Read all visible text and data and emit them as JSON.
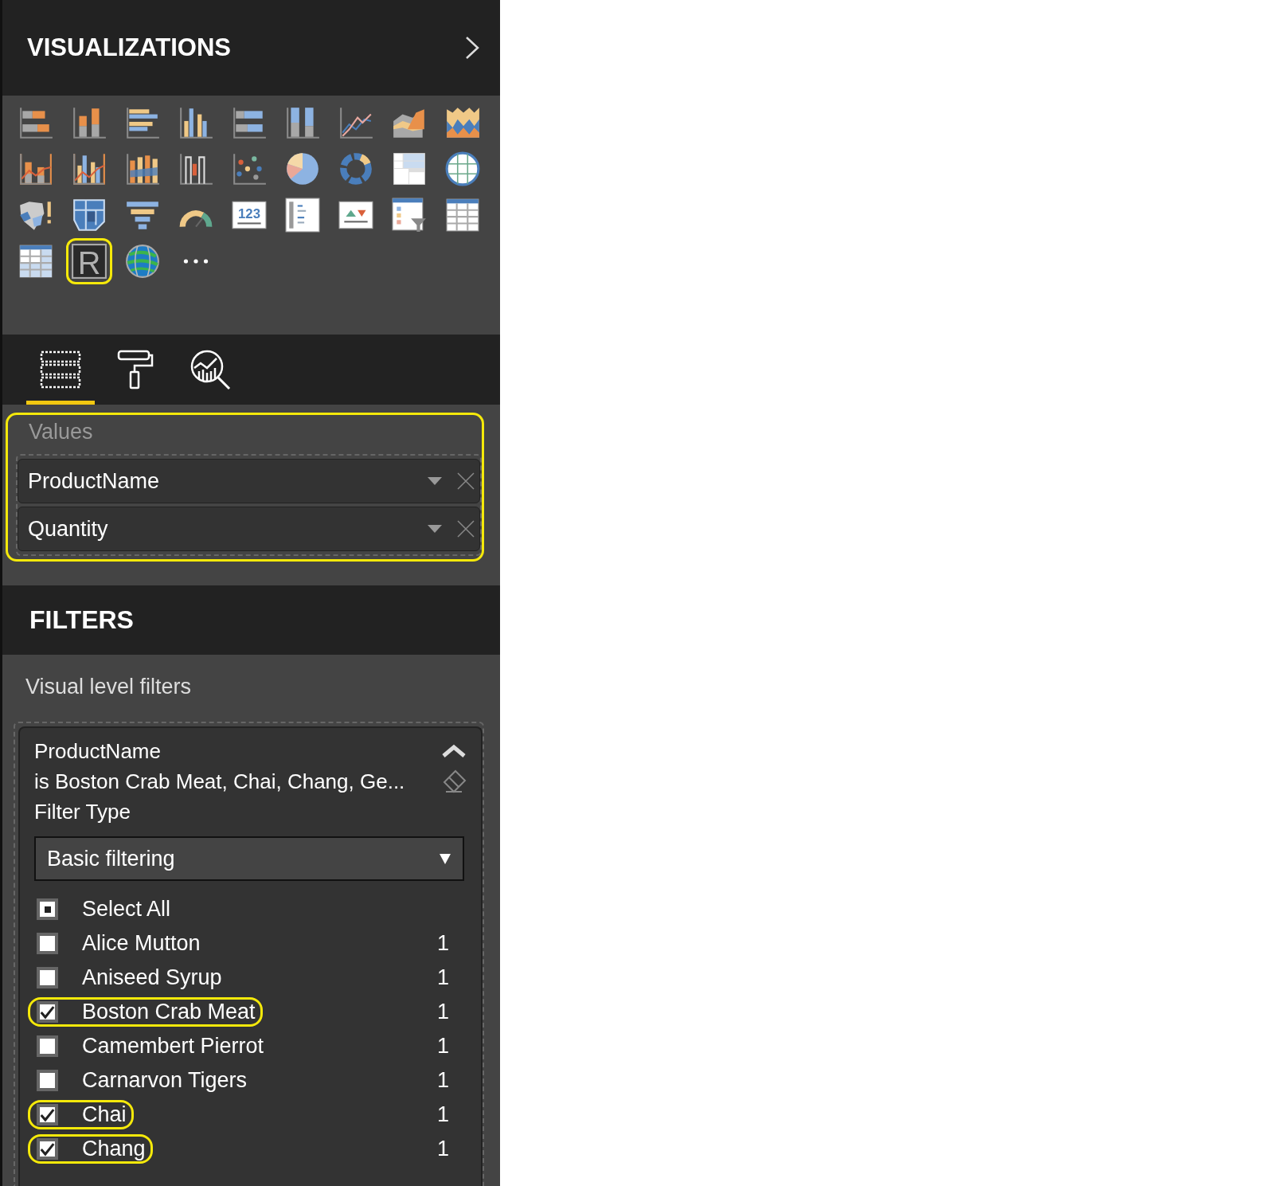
{
  "header": {
    "title": "VISUALIZATIONS"
  },
  "visuals": [
    {
      "kind": "stacked-bar",
      "highlighted": false
    },
    {
      "kind": "stacked-column",
      "highlighted": false
    },
    {
      "kind": "clustered-bar",
      "highlighted": false
    },
    {
      "kind": "clustered-column",
      "highlighted": false
    },
    {
      "kind": "percent-bar",
      "highlighted": false
    },
    {
      "kind": "percent-column",
      "highlighted": false
    },
    {
      "kind": "line",
      "highlighted": false
    },
    {
      "kind": "area",
      "highlighted": false
    },
    {
      "kind": "stacked-area",
      "highlighted": false
    },
    {
      "kind": "line-column",
      "highlighted": false
    },
    {
      "kind": "line-clustered-column",
      "highlighted": false
    },
    {
      "kind": "ribbon",
      "highlighted": false
    },
    {
      "kind": "waterfall",
      "highlighted": false
    },
    {
      "kind": "scatter",
      "highlighted": false
    },
    {
      "kind": "pie",
      "highlighted": false
    },
    {
      "kind": "donut",
      "highlighted": false
    },
    {
      "kind": "treemap",
      "highlighted": false
    },
    {
      "kind": "map",
      "highlighted": false
    },
    {
      "kind": "filled-map",
      "highlighted": false
    },
    {
      "kind": "shape-map",
      "highlighted": false
    },
    {
      "kind": "funnel",
      "highlighted": false
    },
    {
      "kind": "gauge",
      "highlighted": false
    },
    {
      "kind": "card",
      "label": "123",
      "highlighted": false
    },
    {
      "kind": "multi-row-card",
      "highlighted": false
    },
    {
      "kind": "kpi",
      "highlighted": false
    },
    {
      "kind": "slicer",
      "highlighted": false
    },
    {
      "kind": "table",
      "highlighted": false
    },
    {
      "kind": "matrix",
      "highlighted": false
    },
    {
      "kind": "r-script",
      "label": "R",
      "highlighted": true
    },
    {
      "kind": "globe",
      "highlighted": false
    },
    {
      "kind": "more",
      "highlighted": false
    }
  ],
  "tabs": [
    {
      "kind": "fields",
      "selected": true
    },
    {
      "kind": "format",
      "selected": false
    },
    {
      "kind": "analytics",
      "selected": false
    }
  ],
  "values": {
    "label": "Values",
    "highlighted": true,
    "fields": [
      "ProductName",
      "Quantity"
    ]
  },
  "filters": {
    "title": "FILTERS",
    "section": "Visual level filters",
    "card": {
      "field": "ProductName",
      "summary": "is Boston Crab Meat, Chai, Chang, Ge...",
      "filter_type_label": "Filter Type",
      "filter_type": "Basic filtering",
      "items": [
        {
          "label": "Select All",
          "indeterminate": true,
          "highlighted": false
        },
        {
          "label": "Alice Mutton",
          "count": "1",
          "checked": false,
          "highlighted": false
        },
        {
          "label": "Aniseed Syrup",
          "count": "1",
          "checked": false,
          "highlighted": false
        },
        {
          "label": "Boston Crab Meat",
          "count": "1",
          "checked": true,
          "highlighted": true
        },
        {
          "label": "Camembert Pierrot",
          "count": "1",
          "checked": false,
          "highlighted": false
        },
        {
          "label": "Carnarvon Tigers",
          "count": "1",
          "checked": false,
          "highlighted": false
        },
        {
          "label": "Chai",
          "count": "1",
          "checked": true,
          "highlighted": true
        },
        {
          "label": "Chang",
          "count": "1",
          "checked": true,
          "highlighted": true
        }
      ]
    }
  }
}
